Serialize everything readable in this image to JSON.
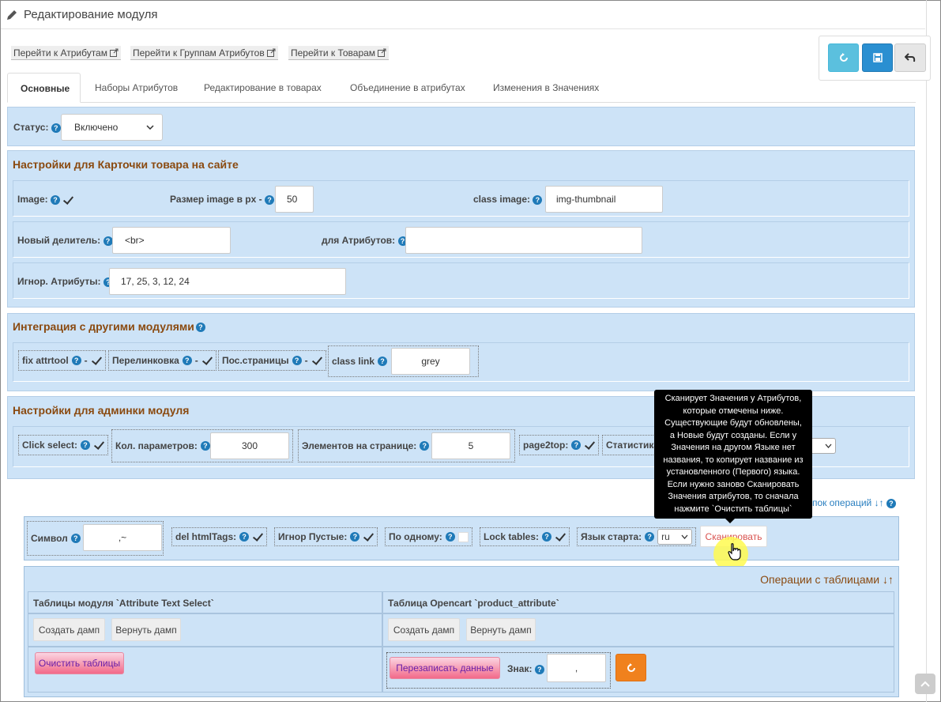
{
  "header": {
    "title": "Редактирование модуля",
    "icon": "pencil-icon"
  },
  "nav_links": [
    {
      "label": "Перейти к Атрибутам"
    },
    {
      "label": "Перейти к Группам Атрибутов"
    },
    {
      "label": "Перейти к Товарам"
    }
  ],
  "action_buttons": [
    {
      "icon": "refresh-icon",
      "color": "#5bc0de"
    },
    {
      "icon": "save-icon",
      "color": "#2a8fd1"
    },
    {
      "icon": "back-arrow-icon",
      "color": "#e6e6e6"
    }
  ],
  "tabs": [
    {
      "label": "Основные",
      "active": true
    },
    {
      "label": "Наборы Атрибутов"
    },
    {
      "label": "Редактирование в товарах"
    },
    {
      "label": "Объединение в атрибутах"
    },
    {
      "label": "Изменения в Значениях"
    }
  ],
  "status": {
    "label": "Статус:",
    "value": "Включено"
  },
  "card_settings": {
    "title": "Настройки для Карточки товара на сайте",
    "image_label": "Image:",
    "image_checked": true,
    "size_label": "Размер image в px -",
    "size_value": "50",
    "class_image_label": "class image:",
    "class_image_value": "img-thumbnail",
    "divider_label": "Новый делитель:",
    "divider_value": "<br>",
    "attr_label": "для Атрибутов:",
    "attr_value": "",
    "ignore_label": "Игнор. Атрибуты:",
    "ignore_value": "17, 25, 3, 12, 24"
  },
  "integration": {
    "title": "Интеграция с другими модулями",
    "items": [
      {
        "label": "fix attrtool",
        "suffix": "-"
      },
      {
        "label": "Перелинковка",
        "suffix": "-"
      },
      {
        "label": "Пос.страницы",
        "suffix": "-"
      }
    ],
    "class_link_label": "class link",
    "class_link_value": "grey"
  },
  "admin": {
    "title": "Настройки для админки модуля",
    "click_select_label": "Click select:",
    "params_label": "Кол. параметров:",
    "params_value": "300",
    "per_page_label": "Элементов на странице:",
    "per_page_value": "5",
    "page2top_label": "page2top:",
    "stats_label": "Статистика:"
  },
  "ops_link": "пок операций ↓↑",
  "scan": {
    "symbol_label": "Символ",
    "symbol_value": ",~",
    "del_tags_label": "del htmlTags:",
    "ignore_empty_label": "Игнор Пустые:",
    "one_by_one_label": "По одному:",
    "lock_tables_label": "Lock tables:",
    "lang_label": "Язык старта:",
    "lang_value": "ru",
    "scan_button": "Сканировать"
  },
  "tooltip": "Сканирует Значения у Атрибутов, которые отмечены ниже. Существующие будут обновлены, а Новые будут созданы. Если у Значения на другом Языке нет названия, то копирует название из установленного (Первого) языка. Если нужно заново Сканировать Значения атрибутов, то сначала нажмите `Очистить таблицы`",
  "tooltip_lines": [
    "Сканирует Значения у Атрибутов,",
    "которые отмечены ниже.",
    "Существующие будут обновлены,",
    "а Новые будут созданы. Если у",
    "Значения на другом Языке нет",
    "названия, то копирует название из",
    "установленного (Первого) языка.",
    "Если нужно заново Сканировать",
    "Значения атрибутов, то сначала",
    "нажмите `Очистить таблицы`"
  ],
  "tables": {
    "title": "Операции с таблицами ↓↑",
    "left_header": "Таблицы модуля `Attribute Text Select`",
    "right_header": "Таблица Opencart `product_attribute`",
    "create_dump": "Создать дамп",
    "restore_dump": "Вернуть дамп",
    "clear_tables": "Очистить таблицы",
    "rewrite_data": "Перезаписать данные",
    "sign_label": "Знак:",
    "sign_value": ","
  }
}
